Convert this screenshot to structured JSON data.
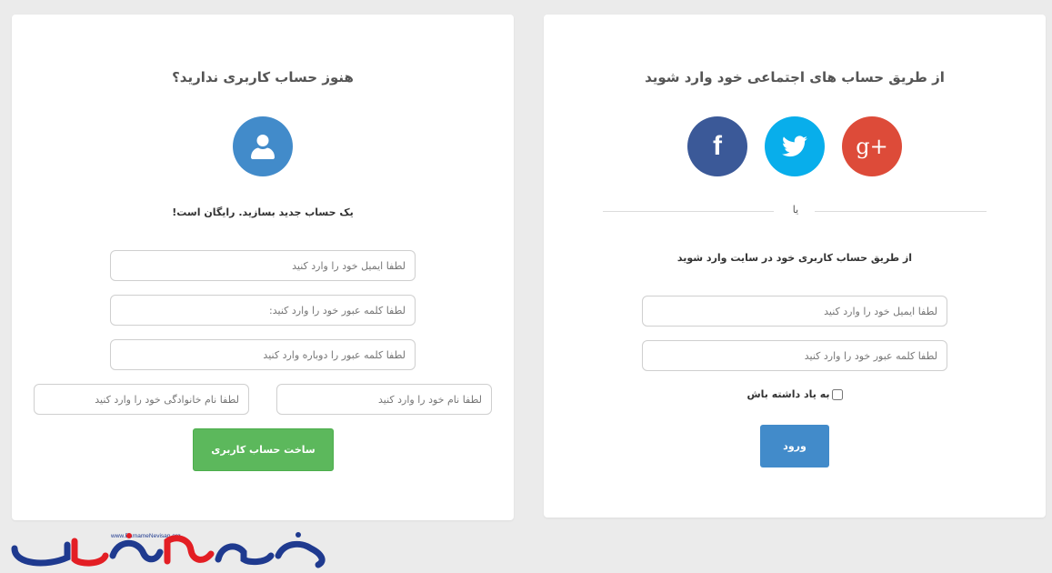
{
  "colors": {
    "google": "#dd4b39",
    "twitter": "#08aeeb",
    "facebook": "#3b5998",
    "user_icon_bg": "#428bca",
    "login_button": "#428bca",
    "signup_button": "#5cb85c",
    "logo_blue": "#1f3a8f",
    "logo_red": "#e31e24"
  },
  "login": {
    "social_heading": "از طریق حساب های اجتماعی خود وارد شوید",
    "social_icons": [
      "google-plus-icon",
      "twitter-icon",
      "facebook-icon"
    ],
    "google_label": "g+",
    "facebook_label": "f",
    "divider_text": "یا",
    "site_heading": "از طریق حساب کاربری خود در سایت وارد شوید",
    "email_placeholder": "لطفا ایمیل خود را وارد کنید",
    "password_placeholder": "لطفا کلمه عبور خود را وارد کنید",
    "remember_label": "به یاد داشته باش",
    "submit_label": "ورود"
  },
  "signup": {
    "heading": "هنوز حساب کاربری ندارید؟",
    "icon": "user-icon",
    "subtext": "یک حساب جدید بسازید. رایگان است!",
    "email_placeholder": "لطفا ایمیل خود را وارد کنید",
    "password_placeholder": "لطفا کلمه عبور خود را وارد کنید:",
    "password_repeat_placeholder": "لطفا کلمه عبور را دوباره وارد کنید",
    "first_name_placeholder": "لطفا نام خود را وارد کنید",
    "last_name_placeholder": "لطفا نام خانوادگی خود را وارد کنید",
    "submit_label": "ساخت حساب کاربری"
  },
  "logo": {
    "url_text": "www.BarnameNevisan.org",
    "brand_text": "برنامه نویسان"
  }
}
